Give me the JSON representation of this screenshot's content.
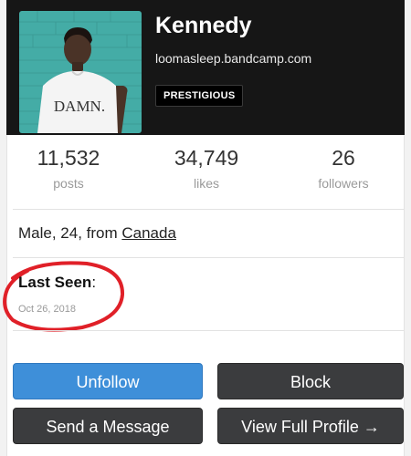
{
  "profile": {
    "username": "Kennedy",
    "website": "loomasleep.bandcamp.com",
    "badge": "PRESTIGIOUS",
    "avatar_shirt_text": "DAMN."
  },
  "stats": [
    {
      "value": "11,532",
      "label": "posts"
    },
    {
      "value": "34,749",
      "label": "likes"
    },
    {
      "value": "26",
      "label": "followers"
    }
  ],
  "info": {
    "prefix": "Male, 24, from ",
    "country": "Canada"
  },
  "last_seen": {
    "label": "Last Seen",
    "colon": ":",
    "date": "Oct 26, 2018"
  },
  "buttons": {
    "unfollow": "Unfollow",
    "block": "Block",
    "message": "Send a Message",
    "profile": "View Full Profile →"
  },
  "colors": {
    "header_bg": "#161616",
    "primary_button": "#3e8fd9",
    "dark_button": "#3b3c3e",
    "annotation": "#e02028"
  }
}
